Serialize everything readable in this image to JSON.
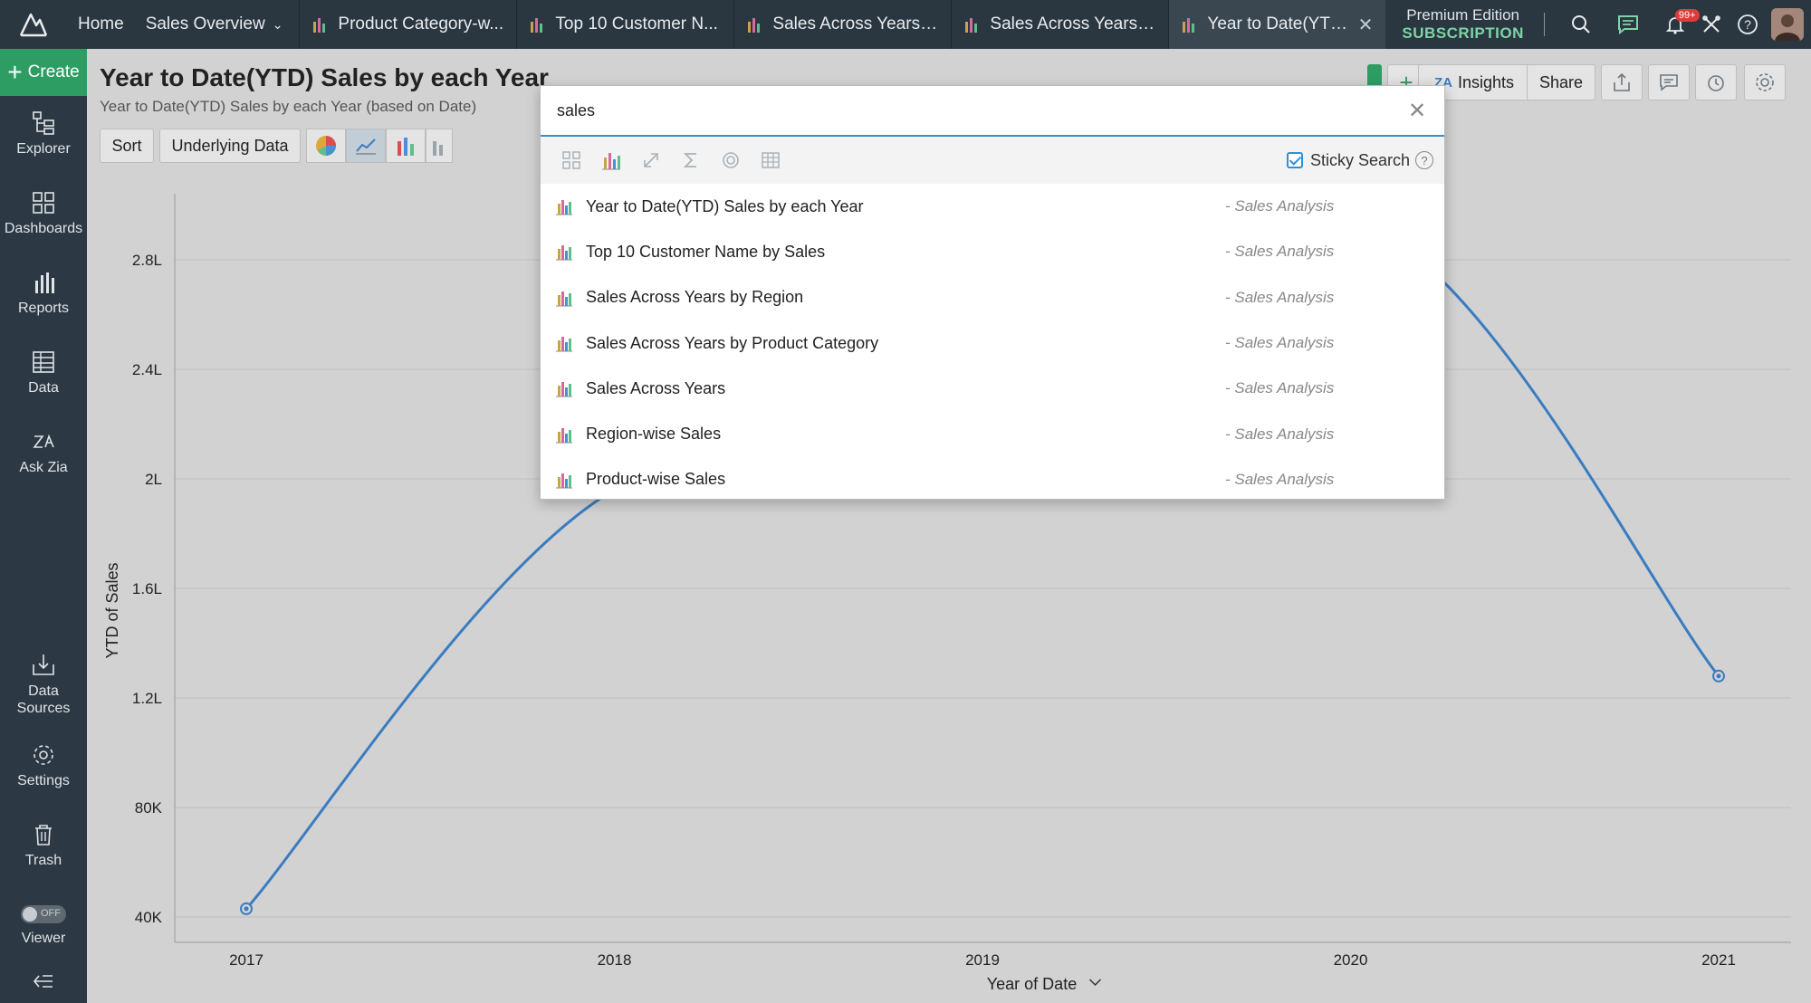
{
  "topbar": {
    "home": "Home",
    "workspace": "Sales Overview",
    "tabs": [
      {
        "label": "Product Category-w..."
      },
      {
        "label": "Top 10 Customer N..."
      },
      {
        "label": "Sales Across Years b..."
      },
      {
        "label": "Sales Across Years b..."
      },
      {
        "label": "Year to Date(YTD) S...",
        "active": true
      }
    ],
    "edition": "Premium Edition",
    "subscription": "SUBSCRIPTION",
    "notification_count": "99+"
  },
  "sidebar": {
    "create": "Create",
    "items": [
      {
        "label": "Explorer",
        "icon": "explorer-icon"
      },
      {
        "label": "Dashboards",
        "icon": "dashboards-icon"
      },
      {
        "label": "Reports",
        "icon": "reports-icon"
      },
      {
        "label": "Data",
        "icon": "data-icon"
      },
      {
        "label": "Ask Zia",
        "icon": "ask-zia-icon"
      },
      {
        "label": "Data Sources",
        "icon": "data-sources-icon"
      },
      {
        "label": "Settings",
        "icon": "settings-icon"
      },
      {
        "label": "Trash",
        "icon": "trash-icon"
      },
      {
        "label": "Viewer",
        "icon": "toggle-icon"
      }
    ],
    "viewer_state": "OFF"
  },
  "report": {
    "title": "Year to Date(YTD) Sales by each Year",
    "description": "Year to Date(YTD) Sales by each Year (based on Date)",
    "sort": "Sort",
    "underlying_data": "Underlying Data",
    "insights": "Insights",
    "share": "Share"
  },
  "search": {
    "query": "sales",
    "sticky_label": "Sticky Search",
    "sticky_checked": true,
    "results": [
      {
        "name": "Year to Date(YTD) Sales by each Year",
        "source": "- Sales Analysis"
      },
      {
        "name": "Top 10 Customer Name by Sales",
        "source": "- Sales Analysis"
      },
      {
        "name": "Sales Across Years by Region",
        "source": "- Sales Analysis"
      },
      {
        "name": "Sales Across Years by Product Category",
        "source": "- Sales Analysis"
      },
      {
        "name": "Sales Across Years",
        "source": "- Sales Analysis"
      },
      {
        "name": "Region-wise Sales",
        "source": "- Sales Analysis"
      },
      {
        "name": "Product-wise Sales",
        "source": "- Sales Analysis"
      }
    ]
  },
  "colors": {
    "line": "#3a7cc0",
    "accent_green": "#2e9d64",
    "topbar_bg": "#2a3640"
  },
  "chart_data": {
    "type": "line",
    "title": "",
    "xlabel": "Year of Date",
    "ylabel": "YTD of Sales",
    "categories": [
      "2017",
      "2018",
      "2019",
      "2020",
      "2021"
    ],
    "y_ticks": [
      "40K",
      "80K",
      "1.2L",
      "1.6L",
      "2L",
      "2.4L",
      "2.8L"
    ],
    "y_tick_values": [
      40000,
      80000,
      120000,
      160000,
      200000,
      240000,
      280000
    ],
    "series": [
      {
        "values": [
          43000,
          196000,
          198000,
          295000,
          128000
        ]
      }
    ],
    "ylim": [
      35000,
      310000
    ],
    "grid": true,
    "smooth": true
  }
}
